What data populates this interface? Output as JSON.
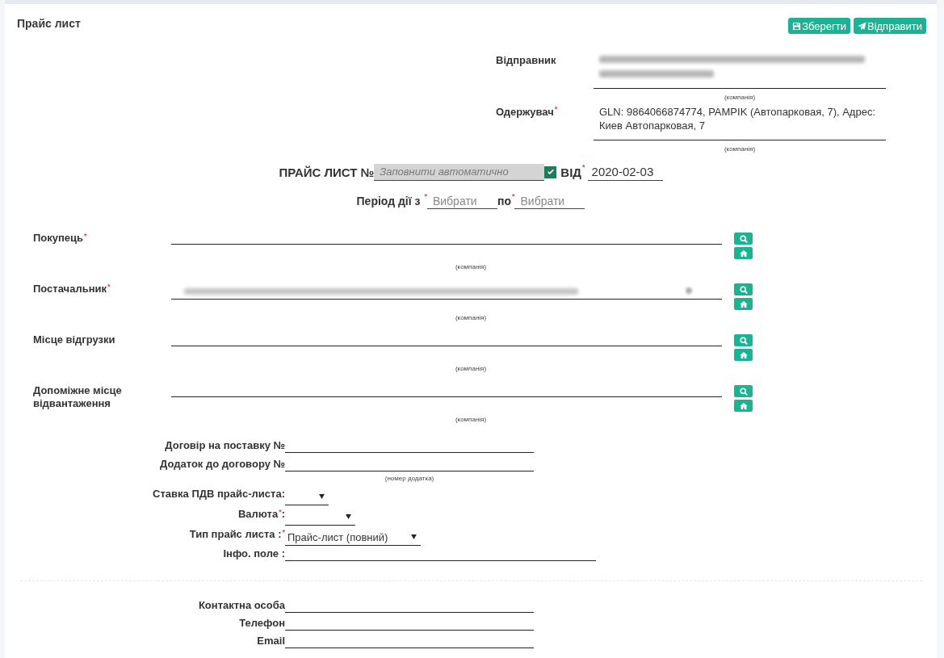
{
  "page": {
    "title": "Прайс лист"
  },
  "toolbar": {
    "buttons": [
      {
        "kind": "save",
        "label": "Зберегти"
      },
      {
        "kind": "send",
        "label": "Відправити"
      }
    ]
  },
  "parties": [
    {
      "label": "Відправник",
      "blurred": true,
      "hint": "(компанія)"
    },
    {
      "label": "Одержувач$^{*}$",
      "blurred": false,
      "value": "GLN: 9864066874774, PAMPIK (Автопарковая, 7), Адрес: Киев Автопарковая, 7",
      "hint": "(компанія)"
    }
  ],
  "header": {
    "number_label": "ПРАЙС ЛИСТ №",
    "number_field": {
      "placeholder": "Заповнити автоматично"
    },
    "auto_number": {
      "checked": true
    },
    "date_label": "ВІД$^{*}$",
    "date_field": {
      "value": "2020-02-03"
    }
  },
  "period": {
    "from_label": "Період дії з $^{*}$",
    "from_field": {
      "placeholder": "Вибрати"
    },
    "to_label": "по$^{*}$",
    "to_field": {
      "placeholder": "Вибрати"
    }
  },
  "companies": [
    {
      "label": "Покупець$^{*}$",
      "blurred": false,
      "hint": "(компанія)"
    },
    {
      "label": "Постачальник$^{*}$",
      "blurred": true,
      "hint": "(компанія)"
    },
    {
      "label": "Місце відгрузки",
      "blurred": false,
      "hint": "(компанія)"
    },
    {
      "label": "Допоміжне місце відвантаження",
      "blurred": false,
      "hint": "(компанія)"
    }
  ],
  "contract": [
    {
      "kind": "text",
      "label": "Договір на поставку №"
    },
    {
      "kind": "text",
      "label": "Додаток до договору №",
      "hint": "(номер додатка)"
    },
    {
      "kind": "select",
      "label": "Ставка ПДВ прайс-листа:"
    },
    {
      "kind": "select",
      "label": "Валюта$^{*}$:"
    },
    {
      "kind": "select",
      "label": "Тип прайс листа :$^{*}$",
      "value": "Прайс-лист (повний)"
    },
    {
      "kind": "text",
      "label": "Інфо. поле :"
    }
  ],
  "contacts": [
    {
      "label": "Контактна особа"
    },
    {
      "label": "Телефон"
    },
    {
      "label": "Email"
    }
  ]
}
